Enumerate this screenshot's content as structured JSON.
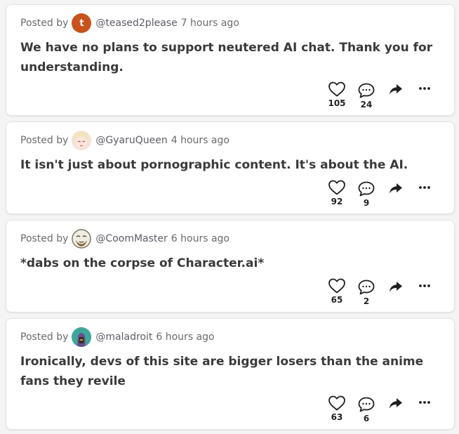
{
  "posts": [
    {
      "posted_by_label": "Posted by",
      "avatar_letter": "t",
      "avatar_color": "#c8521c",
      "avatar_icon": "letter-avatar",
      "handle": "@teased2please",
      "time": "7 hours ago",
      "text": "We have no plans to support neutered AI chat. Thank you for understanding.",
      "likes": "105",
      "comments": "24"
    },
    {
      "posted_by_label": "Posted by",
      "avatar_letter": "",
      "avatar_color": "#f5d6c8",
      "avatar_icon": "anime-girl-avatar",
      "handle": "@GyaruQueen",
      "time": "4 hours ago",
      "text": "It isn't just about pornographic content. It's about the AI.",
      "likes": "92",
      "comments": "9"
    },
    {
      "posted_by_label": "Posted by",
      "avatar_letter": "",
      "avatar_color": "#e8e2cf",
      "avatar_icon": "bearded-face-avatar",
      "handle": "@CoomMaster",
      "time": "6 hours ago",
      "text": "*dabs on the corpse of Character.ai*",
      "likes": "65",
      "comments": "2"
    },
    {
      "posted_by_label": "Posted by",
      "avatar_letter": "",
      "avatar_color": "#3fa79a",
      "avatar_icon": "hooded-figure-avatar",
      "handle": "@maladroit",
      "time": "6 hours ago",
      "text": "Ironically, devs of this site are bigger losers than the anime fans they revile",
      "likes": "63",
      "comments": "6"
    }
  ]
}
